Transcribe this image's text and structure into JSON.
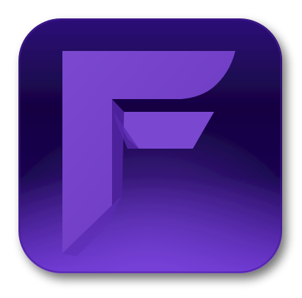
{
  "image": {
    "kind": "app-icon",
    "icon_name": "f-letter-logo-icon",
    "background": "#ffffff",
    "colors": {
      "tile_dark": "#140640",
      "tile_mid": "#2a0d78",
      "tile_light": "#6230c8",
      "letter_main": "#7342c6",
      "letter_highlight": "#8a57d8",
      "letter_shadow": "#4a1f9a",
      "shadow": "#000000"
    }
  }
}
